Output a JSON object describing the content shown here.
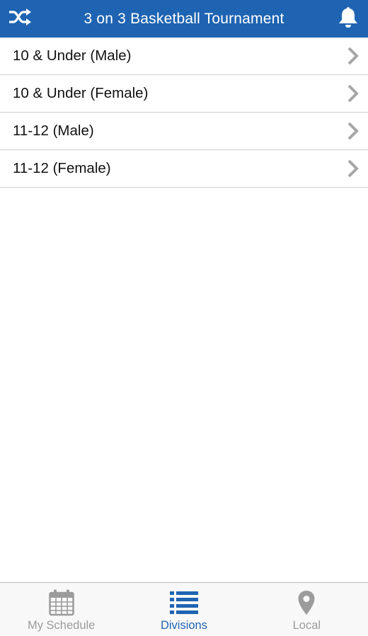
{
  "colors": {
    "brand": "#1f64b2",
    "inactive": "#9b9b9b",
    "chevron": "#a6a6a6",
    "divider": "#cfcfcf"
  },
  "header": {
    "title": "3 on 3 Basketball Tournament",
    "left_icon": "shuffle-icon",
    "right_icon": "bell-icon"
  },
  "divisions": [
    {
      "label": "10 & Under (Male)"
    },
    {
      "label": "10 & Under (Female)"
    },
    {
      "label": "11-12 (Male)"
    },
    {
      "label": "11-12 (Female)"
    }
  ],
  "tabbar": {
    "tabs": [
      {
        "label": "My Schedule",
        "icon": "calendar-icon",
        "active": false
      },
      {
        "label": "Divisions",
        "icon": "list-icon",
        "active": true
      },
      {
        "label": "Local",
        "icon": "map-pin-icon",
        "active": false
      }
    ]
  }
}
